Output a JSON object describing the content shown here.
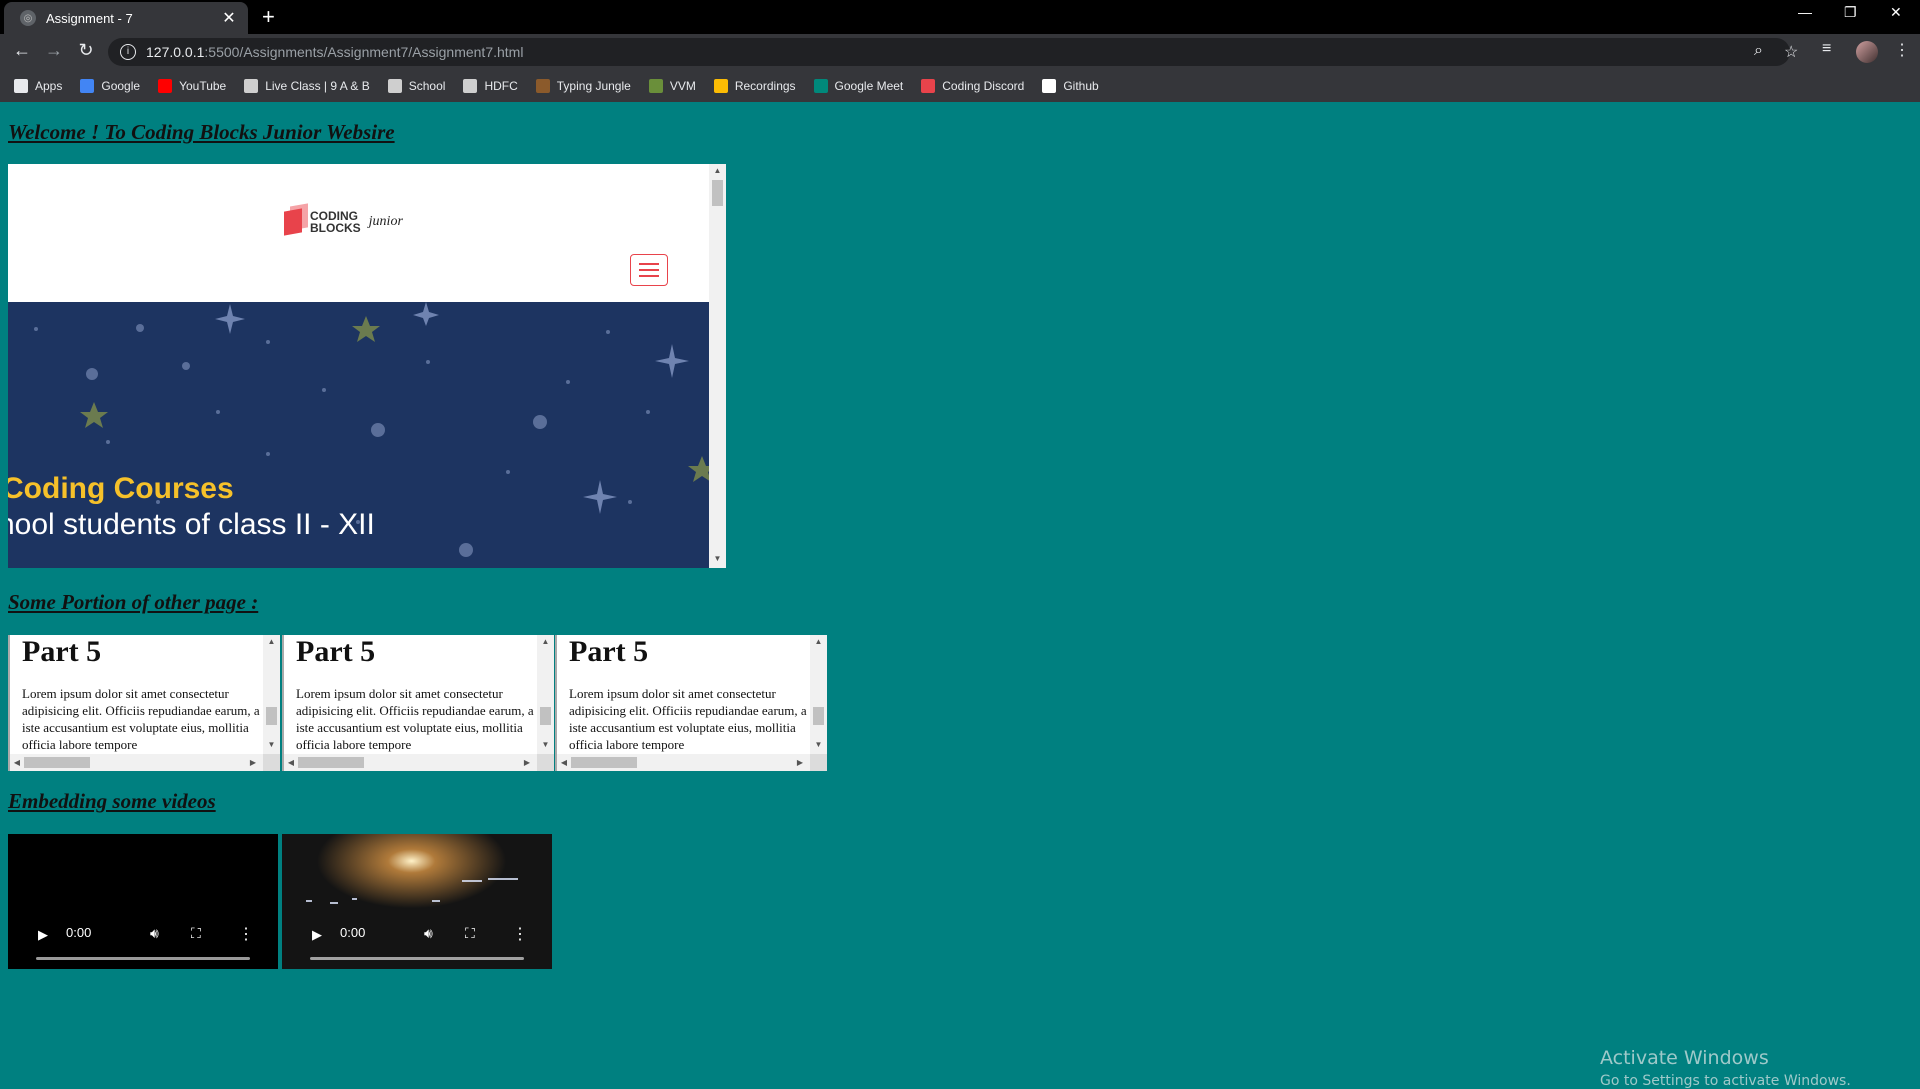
{
  "browser": {
    "tab_title": "Assignment - 7",
    "tab_close": "✕",
    "new_tab": "+",
    "url_host": "127.0.0.1",
    "url_path": ":5500/Assignments/Assignment7/Assignment7.html",
    "bookmarks": [
      {
        "label": "Apps",
        "color": "#e8eaed"
      },
      {
        "label": "Google",
        "color": "#4285f4"
      },
      {
        "label": "YouTube",
        "color": "#ff0000"
      },
      {
        "label": "Live Class | 9 A & B",
        "color": "#cfcfcf"
      },
      {
        "label": "School",
        "color": "#cfcfcf"
      },
      {
        "label": "HDFC",
        "color": "#cfcfcf"
      },
      {
        "label": "Typing Jungle",
        "color": "#8b5a2b"
      },
      {
        "label": "VVM",
        "color": "#6a8f3a"
      },
      {
        "label": "Recordings",
        "color": "#fbbc04"
      },
      {
        "label": "Google Meet",
        "color": "#00897b"
      },
      {
        "label": "Coding Discord",
        "color": "#e8434b"
      },
      {
        "label": "Github",
        "color": "#ffffff"
      }
    ]
  },
  "page": {
    "heading1": "Welcome ! To Coding Blocks Junior Websire",
    "heading2": "Some Portion of other page :",
    "heading3": "Embedding some videos",
    "embed": {
      "logo_line1": "CODING",
      "logo_line2": "BLOCKS",
      "logo_junior": "junior",
      "hero_title": "Coding Courses",
      "hero_sub": "hool students of class II - XII"
    },
    "parts": [
      {
        "title": "Part 5",
        "text": "Lorem ipsum dolor sit amet consectetur adipisicing elit. Officiis repudiandae earum, a iste accusantium est voluptate eius, mollitia officia labore tempore"
      },
      {
        "title": "Part 5",
        "text": "Lorem ipsum dolor sit amet consectetur adipisicing elit. Officiis repudiandae earum, a iste accusantium est voluptate eius, mollitia officia labore tempore"
      },
      {
        "title": "Part 5",
        "text": "Lorem ipsum dolor sit amet consectetur adipisicing elit. Officiis repudiandae earum, a iste accusantium est voluptate eius, mollitia officia labore tempore"
      }
    ],
    "videos": [
      {
        "time": "0:00"
      },
      {
        "time": "0:00"
      }
    ]
  },
  "watermark": {
    "line1": "Activate Windows",
    "line2": "Go to Settings to activate Windows."
  }
}
